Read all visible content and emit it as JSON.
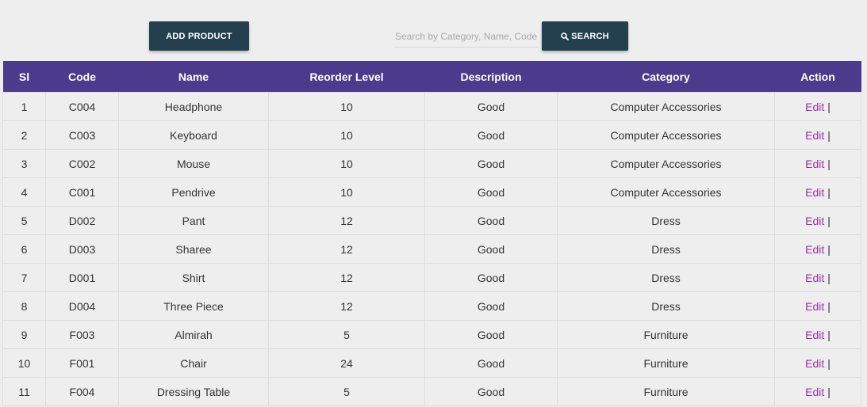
{
  "toolbar": {
    "add_product_label": "ADD PRODUCT",
    "search_placeholder": "Search by Category, Name, Code",
    "search_value": "",
    "search_label": "SEARCH"
  },
  "table": {
    "headers": [
      "Sl",
      "Code",
      "Name",
      "Reorder Level",
      "Description",
      "Category",
      "Action"
    ],
    "rows": [
      {
        "sl": "1",
        "code": "C004",
        "name": "Headphone",
        "reorder": "10",
        "description": "Good",
        "category": "Computer Accessories",
        "action": "Edit",
        "sep": "|"
      },
      {
        "sl": "2",
        "code": "C003",
        "name": "Keyboard",
        "reorder": "10",
        "description": "Good",
        "category": "Computer Accessories",
        "action": "Edit",
        "sep": "|"
      },
      {
        "sl": "3",
        "code": "C002",
        "name": "Mouse",
        "reorder": "10",
        "description": "Good",
        "category": "Computer Accessories",
        "action": "Edit",
        "sep": "|"
      },
      {
        "sl": "4",
        "code": "C001",
        "name": "Pendrive",
        "reorder": "10",
        "description": "Good",
        "category": "Computer Accessories",
        "action": "Edit",
        "sep": "|"
      },
      {
        "sl": "5",
        "code": "D002",
        "name": "Pant",
        "reorder": "12",
        "description": "Good",
        "category": "Dress",
        "action": "Edit",
        "sep": "|"
      },
      {
        "sl": "6",
        "code": "D003",
        "name": "Sharee",
        "reorder": "12",
        "description": "Good",
        "category": "Dress",
        "action": "Edit",
        "sep": "|"
      },
      {
        "sl": "7",
        "code": "D001",
        "name": "Shirt",
        "reorder": "12",
        "description": "Good",
        "category": "Dress",
        "action": "Edit",
        "sep": "|"
      },
      {
        "sl": "8",
        "code": "D004",
        "name": "Three Piece",
        "reorder": "12",
        "description": "Good",
        "category": "Dress",
        "action": "Edit",
        "sep": "|"
      },
      {
        "sl": "9",
        "code": "F003",
        "name": "Almirah",
        "reorder": "5",
        "description": "Good",
        "category": "Furniture",
        "action": "Edit",
        "sep": "|"
      },
      {
        "sl": "10",
        "code": "F001",
        "name": "Chair",
        "reorder": "24",
        "description": "Good",
        "category": "Furniture",
        "action": "Edit",
        "sep": "|"
      },
      {
        "sl": "11",
        "code": "F004",
        "name": "Dressing Table",
        "reorder": "5",
        "description": "Good",
        "category": "Furniture",
        "action": "Edit",
        "sep": "|"
      }
    ]
  },
  "colors": {
    "button_bg": "#24404f",
    "header_bg": "#4a3b8c",
    "link": "#9b2fae",
    "page_bg": "#eeeeee"
  },
  "icons": {
    "search": "search-icon"
  }
}
